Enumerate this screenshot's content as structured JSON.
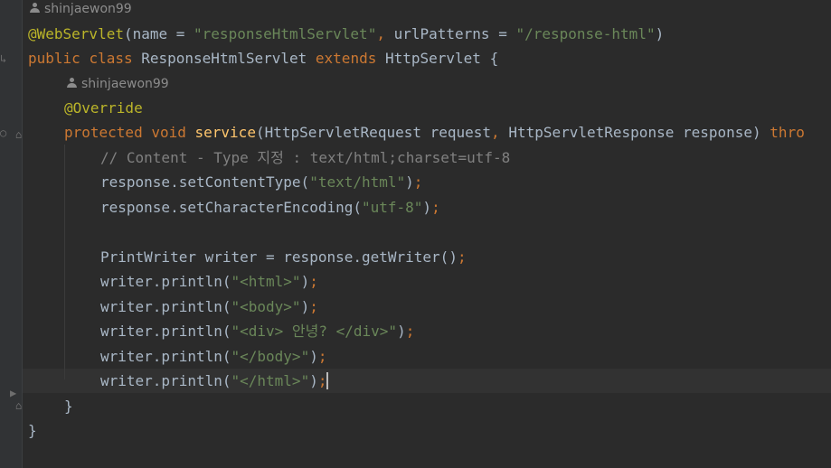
{
  "editor": {
    "hints": {
      "class_author": "shinjaewon99",
      "method_author": "shinjaewon99"
    },
    "lines": {
      "l1": {
        "annotation": "@WebServlet",
        "p1": "(name = ",
        "s1": "\"responseHtmlServlet\"",
        "comma": ", ",
        "p2": "urlPatterns = ",
        "s2": "\"/response-html\"",
        "p3": ")"
      },
      "l2": {
        "k1": "public",
        "sp1": " ",
        "k2": "class",
        "name": " ResponseHtmlServlet ",
        "k3": "extends",
        "rest": " HttpServlet {"
      },
      "l3": {
        "annotation": "@Override"
      },
      "l4": {
        "k1": "protected",
        "sp1": " ",
        "k2": "void",
        "sp2": " ",
        "fn": "service",
        "p1": "(HttpServletRequest request",
        "comma": ", ",
        "p2": "HttpServletResponse response) ",
        "k3": "thro"
      },
      "l5": {
        "comment": "// Content - Type 지정 : text/html;charset=utf-8"
      },
      "l6": {
        "p1": "response.setContentType(",
        "s1": "\"text/html\"",
        "p2": ")",
        "semi": ";"
      },
      "l7": {
        "p1": "response.setCharacterEncoding(",
        "s1": "\"utf-8\"",
        "p2": ")",
        "semi": ";"
      },
      "l8": {
        "p1": "PrintWriter writer = response.getWriter()",
        "semi": ";"
      },
      "l9": {
        "p1": "writer.println(",
        "s1": "\"<html>\"",
        "p2": ")",
        "semi": ";"
      },
      "l10": {
        "p1": "writer.println(",
        "s1": "\"<body>\"",
        "p2": ")",
        "semi": ";"
      },
      "l11": {
        "p1": "writer.println(",
        "s1": "\"<div> 안녕? </div>\"",
        "p2": ")",
        "semi": ";"
      },
      "l12": {
        "p1": "writer.println(",
        "s1": "\"</body>\"",
        "p2": ")",
        "semi": ";"
      },
      "l13": {
        "p1": "writer.println(",
        "s1": "\"</html>\"",
        "p2": ")",
        "semi": ";"
      },
      "l14": {
        "brace": "}"
      },
      "l15": {
        "brace": "}"
      }
    },
    "colors": {
      "background": "#2b2b2b",
      "keyword": "#cc7832",
      "string": "#6a8759",
      "annotation": "#bbb529",
      "function": "#ffc66d",
      "comment": "#808080",
      "text": "#a9b7c6"
    }
  }
}
